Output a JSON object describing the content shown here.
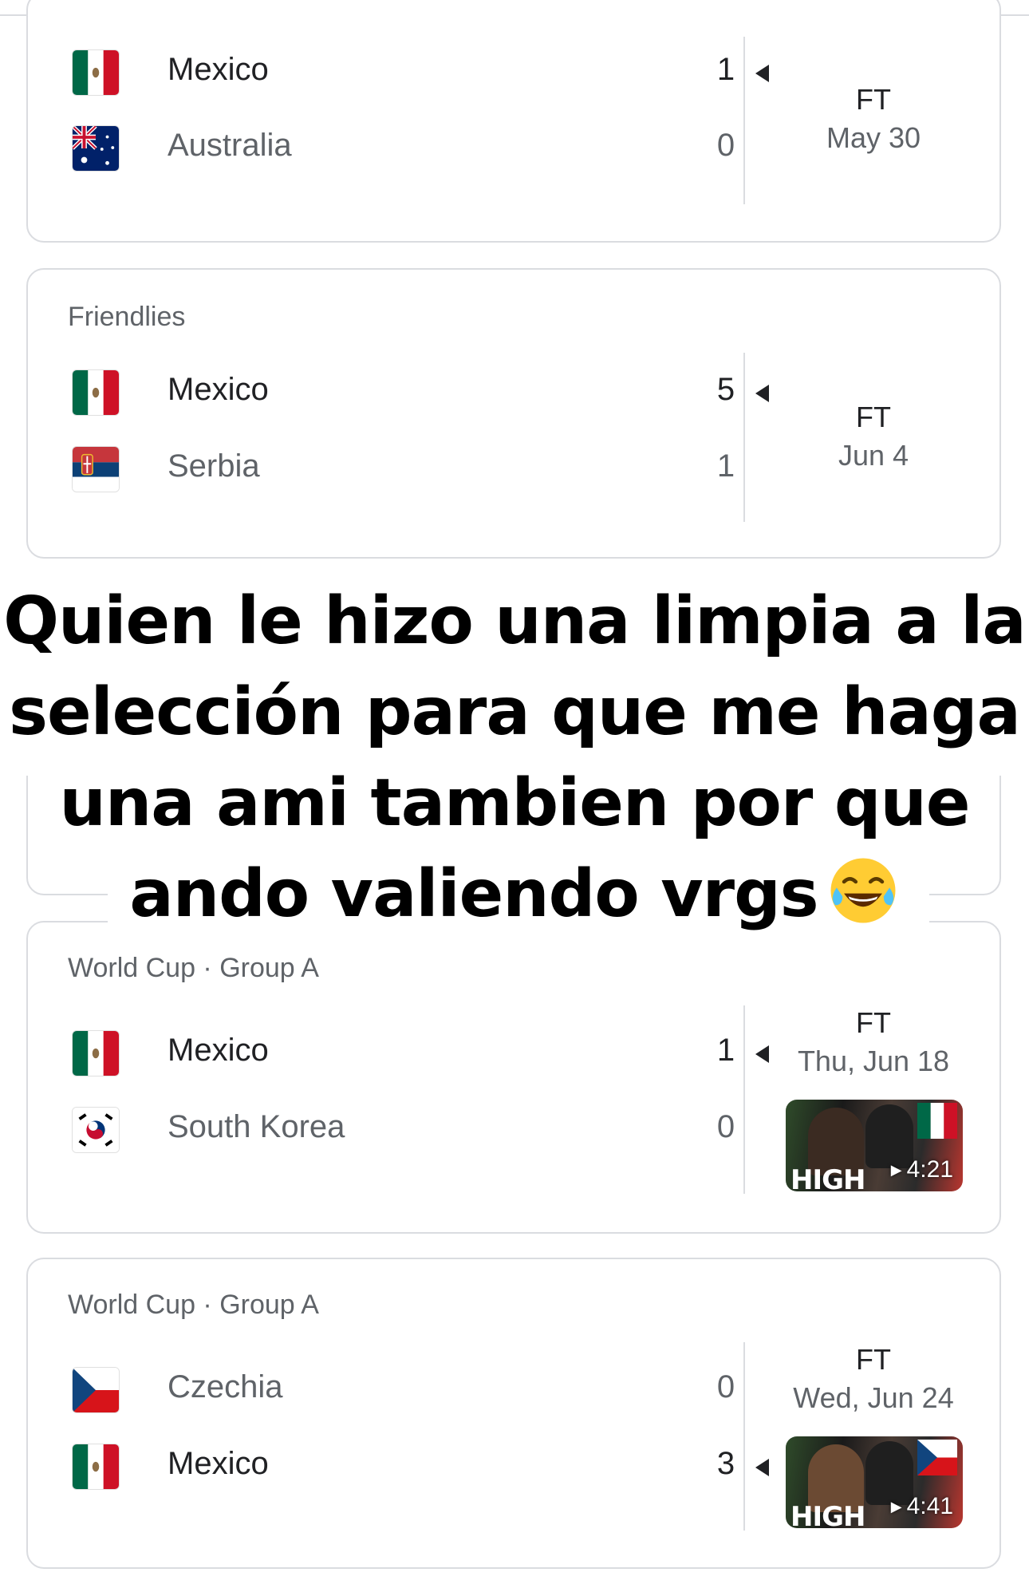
{
  "matches": [
    {
      "league": "",
      "team1": {
        "name": "Mexico",
        "score": "1",
        "flag": "mexico-flag",
        "winner": true
      },
      "team2": {
        "name": "Australia",
        "score": "0",
        "flag": "australia-flag",
        "winner": false
      },
      "status": "FT",
      "date": "May 30"
    },
    {
      "league": "Friendlies",
      "team1": {
        "name": "Mexico",
        "score": "5",
        "flag": "mexico-flag",
        "winner": true
      },
      "team2": {
        "name": "Serbia",
        "score": "1",
        "flag": "serbia-flag",
        "winner": false
      },
      "status": "FT",
      "date": "Jun 4"
    },
    {
      "league": "World Cup · Group A",
      "team1": {
        "name": "Mexico",
        "score": "1",
        "flag": "mexico-flag",
        "winner": true
      },
      "team2": {
        "name": "South Korea",
        "score": "0",
        "flag": "south-korea-flag",
        "winner": false
      },
      "status": "FT",
      "date": "Thu, Jun 18",
      "highlight": {
        "text": "HIGH",
        "duration": "4:21"
      }
    },
    {
      "league": "World Cup · Group A",
      "team1": {
        "name": "Czechia",
        "score": "0",
        "flag": "czechia-flag",
        "winner": false
      },
      "team2": {
        "name": "Mexico",
        "score": "3",
        "flag": "mexico-flag",
        "winner": true
      },
      "status": "FT",
      "date": "Wed, Jun 24",
      "highlight": {
        "text": "HIGH",
        "duration": "4:41"
      }
    }
  ],
  "caption": {
    "line1": "Quien le hizo una limpia a la",
    "line2": "selección para que me haga",
    "line3": "una ami tambien por que",
    "line4": "ando valiendo vrgs",
    "emoji": "laughing-tears-emoji"
  }
}
